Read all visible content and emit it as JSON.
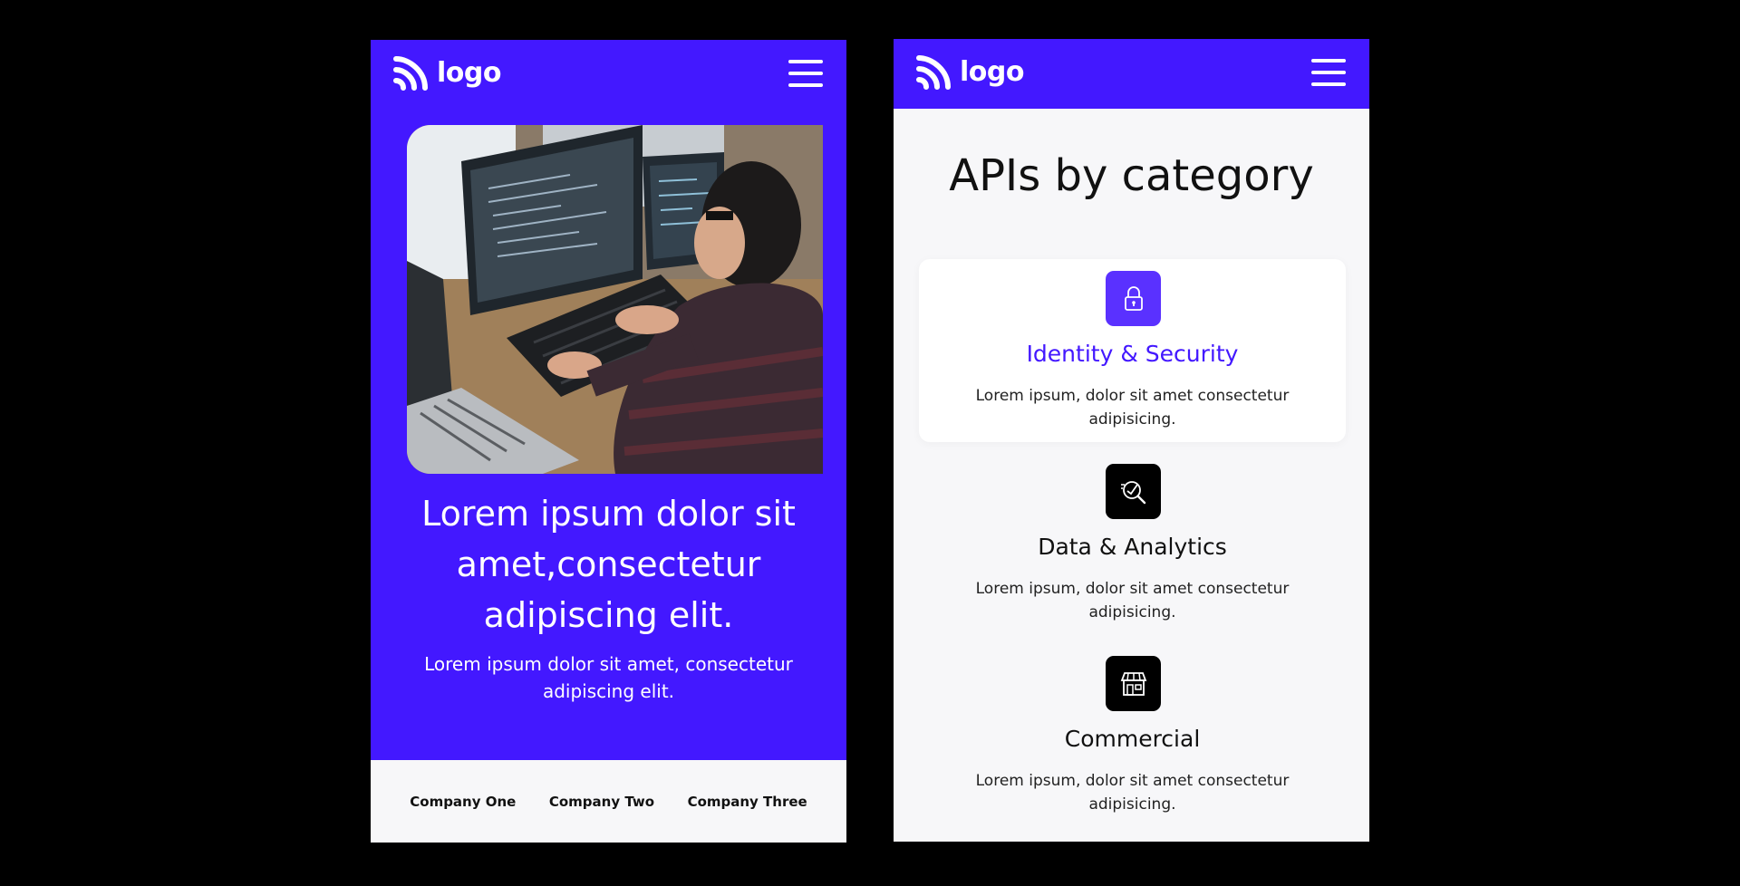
{
  "brand": {
    "logo_text": "logo",
    "primary_color": "#4318ff",
    "icon": "logo-mark-icon"
  },
  "screen_left": {
    "menu_icon": "hamburger-menu-icon",
    "hero": {
      "title": "Lorem ipsum dolor sit amet,consectetur adipiscing elit.",
      "subtitle": "Lorem ipsum dolor sit amet, consectetur adipiscing elit."
    },
    "companies": [
      {
        "label": "Company One"
      },
      {
        "label": "Company Two"
      },
      {
        "label": "Company Three"
      }
    ]
  },
  "screen_right": {
    "menu_icon": "hamburger-menu-icon",
    "section_title": "APIs by category",
    "categories": [
      {
        "title": "Identity & Security",
        "description": "Lorem ipsum, dolor sit amet consectetur adipisicing.",
        "icon": "lock-icon",
        "active": true
      },
      {
        "title": "Data & Analytics",
        "description": "Lorem ipsum, dolor sit amet consectetur adipisicing.",
        "icon": "analytics-search-icon",
        "active": false
      },
      {
        "title": "Commercial",
        "description": "Lorem ipsum, dolor sit amet consectetur adipisicing.",
        "icon": "storefront-icon",
        "active": false
      }
    ]
  }
}
